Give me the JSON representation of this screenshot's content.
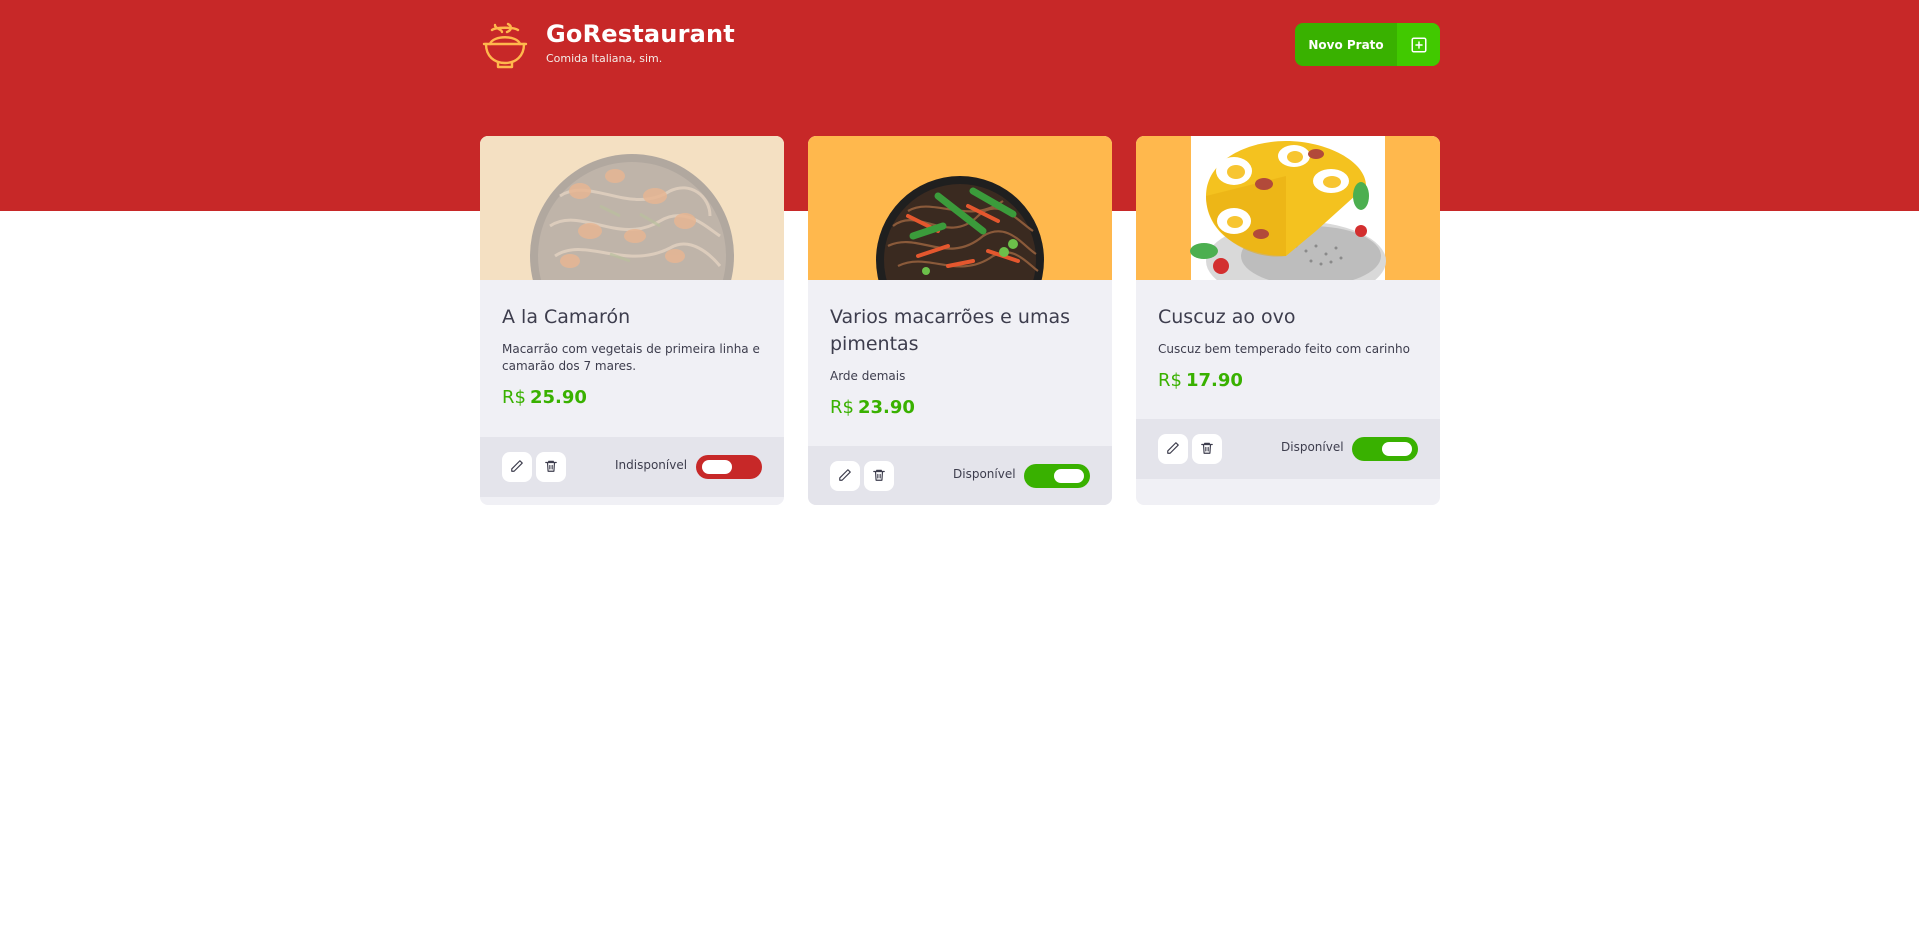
{
  "header": {
    "title": "GoRestaurant",
    "subtitle": "Comida Italiana, sim.",
    "logo_icon": "cooking-bowl-icon",
    "new_dish_button": {
      "label": "Novo Prato",
      "icon": "plus-square-icon"
    }
  },
  "colors": {
    "header_bg": "#c72828",
    "green": "#39b100",
    "red": "#c72828",
    "card_bg": "#f0f0f5",
    "footer_bg": "#e4e4eb"
  },
  "foods": [
    {
      "name": "A la Camarón",
      "description": "Macarrão com vegetais de primeira linha e camarão dos 7 mares.",
      "currency": "R$",
      "price": "25.90",
      "status_label": "Indisponível",
      "available": false
    },
    {
      "name": "Varios macarrões e umas pimentas",
      "description": "Arde demais",
      "currency": "R$",
      "price": "23.90",
      "status_label": "Disponível",
      "available": true
    },
    {
      "name": "Cuscuz ao ovo",
      "description": "Cuscuz bem temperado feito com carinho",
      "currency": "R$",
      "price": "17.90",
      "status_label": "Disponível",
      "available": true
    }
  ],
  "footer_icons": {
    "edit": "pencil-icon",
    "delete": "trash-icon"
  }
}
